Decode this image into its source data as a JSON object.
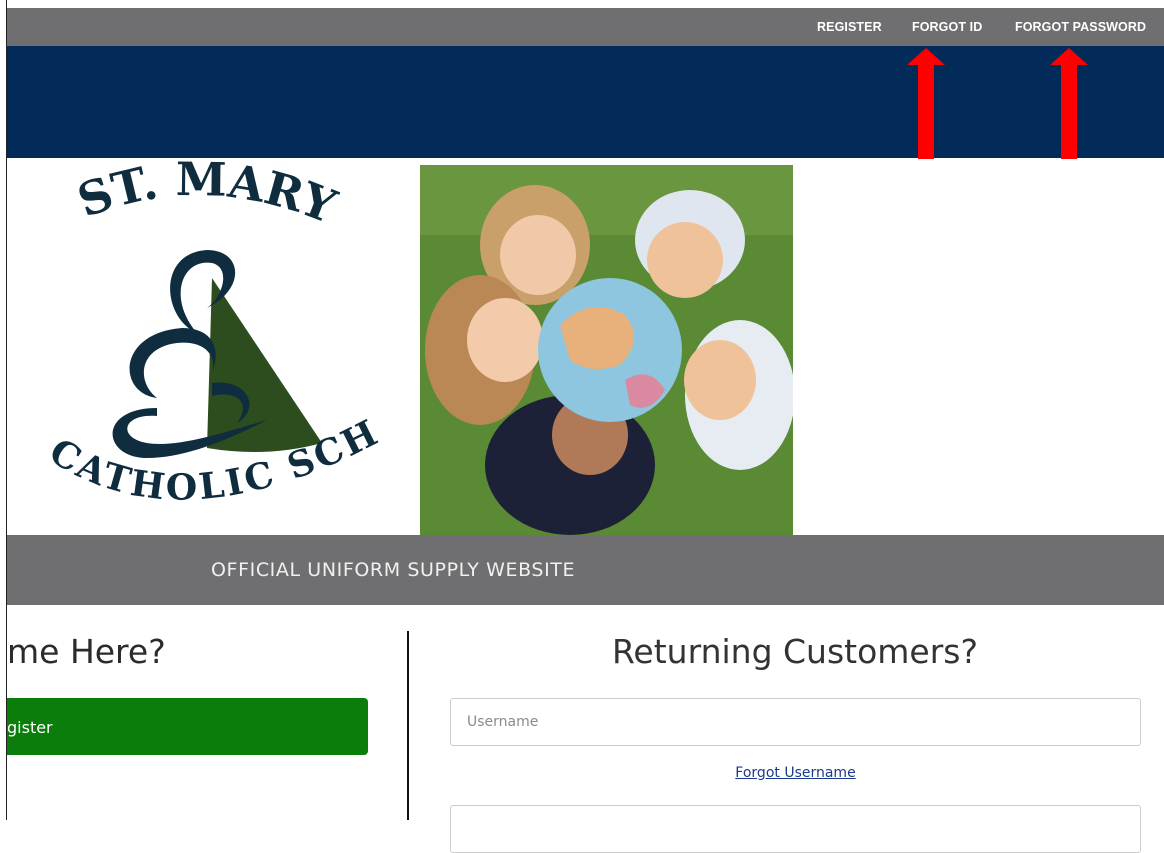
{
  "topbar": {
    "links": [
      {
        "label": "REGISTER"
      },
      {
        "label": "FORGOT ID"
      },
      {
        "label": "FORGOT PASSWORD"
      }
    ]
  },
  "logo": {
    "text_top": "ST. MARY",
    "text_bottom": "CATHOLIC SCHOOL",
    "colors": {
      "navy": "#0f2d3f",
      "green": "#2d4d1f"
    }
  },
  "banner": {
    "text": "OFFICIAL UNIFORM SUPPLY WEBSITE"
  },
  "new_customers": {
    "heading": "me Here?",
    "register_button": "gister"
  },
  "returning": {
    "heading": "Returning Customers?",
    "username_placeholder": "Username",
    "forgot_username": "Forgot Username"
  },
  "colors": {
    "topbar": "#6f6f71",
    "navband": "#032b59",
    "register_green": "#0a7d0a",
    "arrow_red": "#ff0000"
  }
}
